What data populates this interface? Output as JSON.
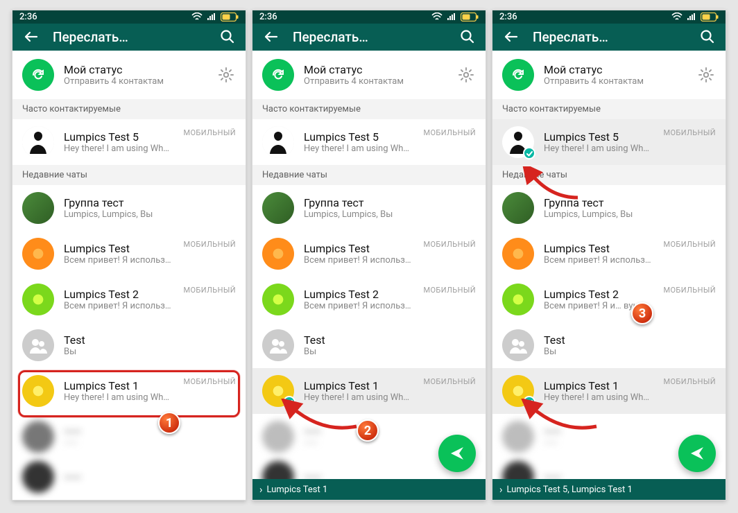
{
  "statusbar": {
    "time": "2:36"
  },
  "header": {
    "title": "Переслать…"
  },
  "mystatus": {
    "title": "Мой статус",
    "subtitle": "Отправить 4 контактам"
  },
  "sections": {
    "frequent": "Часто контактируемые",
    "recent": "Недавние чаты"
  },
  "contacts": {
    "lumpics5": {
      "name": "Lumpics Test 5",
      "sub": "Hey there! I am using WhatsApp.",
      "tag": "МОБИЛЬНЫЙ"
    },
    "group": {
      "name": "Группа тест",
      "sub": "Lumpics, Lumpics, Вы"
    },
    "lumpics": {
      "name": "Lumpics Test",
      "sub": "Всем привет! Я использую WhatsApp.",
      "tag": "МОБИЛЬНЫЙ"
    },
    "lumpics2": {
      "name": "Lumpics Test 2",
      "sub": "Всем привет! Я использую WhatsApp.",
      "tag": "МОБИЛЬНЫЙ"
    },
    "lumpics2_cut": {
      "name": "Lumpics Test 2",
      "sub": "Всем привет! Я и…     вую WhatsApp."
    },
    "test": {
      "name": "Test",
      "sub": "Вы"
    },
    "lumpics1": {
      "name": "Lumpics Test 1",
      "sub": "Hey there! I am using WhatsApp.",
      "tag": "МОБИЛЬНЫЙ"
    }
  },
  "selection": {
    "phone2": "Lumpics Test 1",
    "phone3": "Lumpics Test 5, Lumpics Test 1"
  },
  "annotations": {
    "badge1": "1",
    "badge2": "2",
    "badge3": "3"
  },
  "colors": {
    "statusbar": "#04443b",
    "toolbar": "#075e54",
    "accent": "#0ac159",
    "check": "#06b8a4",
    "highlight": "#d6241f"
  }
}
